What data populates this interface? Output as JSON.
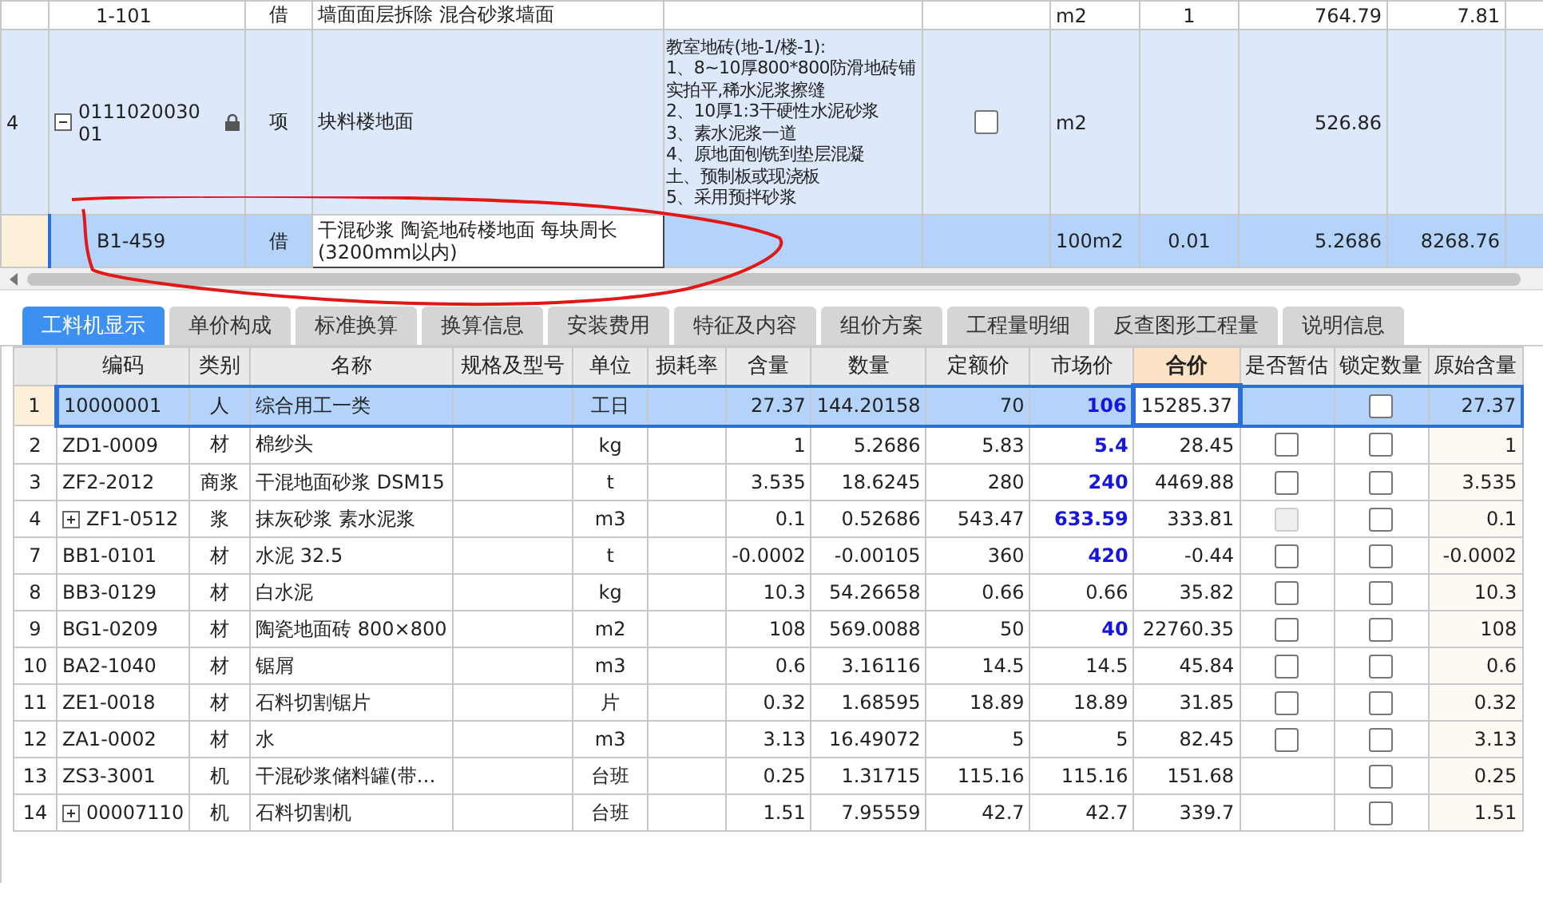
{
  "upper_table": {
    "rows": [
      {
        "row_number": "",
        "code": "1-101",
        "type": "借",
        "name": "墙面面层拆除 混合砂浆墙面",
        "features": [],
        "unit": "m2",
        "quantity": "1",
        "unit_price": "764.79",
        "total": "7.81",
        "selected": false
      },
      {
        "row_number": "4",
        "code": "011102003001",
        "type": "项",
        "name": "块料楼地面",
        "features": [
          "教室地砖(地-1/楼-1):",
          "1、8~10厚800*800防滑地砖铺",
          "实拍平,稀水泥浆擦缝",
          "2、10厚1:3干硬性水泥砂浆",
          "3、素水泥浆一道",
          "4、原地面刨铣到垫层混凝",
          "土、预制板或现浇板",
          "5、采用预拌砂浆"
        ],
        "expanded": true,
        "locked": true,
        "checked": false,
        "unit": "m2",
        "quantity": "",
        "unit_price": "526.86",
        "total": "",
        "selected": false
      },
      {
        "row_number": "",
        "code": "B1-459",
        "type": "借",
        "name": "干混砂浆 陶瓷地砖楼地面 每块周长(3200mm以内)",
        "features": [],
        "unit": "100m2",
        "quantity": "0.01",
        "unit_price": "5.2686",
        "total": "8268.76",
        "selected": true
      }
    ]
  },
  "tabs": [
    {
      "label": "工料机显示",
      "selected": true
    },
    {
      "label": "单价构成",
      "selected": false
    },
    {
      "label": "标准换算",
      "selected": false
    },
    {
      "label": "换算信息",
      "selected": false
    },
    {
      "label": "安装费用",
      "selected": false
    },
    {
      "label": "特征及内容",
      "selected": false
    },
    {
      "label": "组价方案",
      "selected": false
    },
    {
      "label": "工程量明细",
      "selected": false
    },
    {
      "label": "反查图形工程量",
      "selected": false
    },
    {
      "label": "说明信息",
      "selected": false
    }
  ],
  "resource_table": {
    "columns": [
      "编码",
      "类别",
      "名称",
      "规格及型号",
      "单位",
      "损耗率",
      "含量",
      "数量",
      "定额价",
      "市场价",
      "合价",
      "是否暂估",
      "锁定数量",
      "原始含量"
    ],
    "rows": [
      {
        "row_number": "1",
        "code": "10000001",
        "type": "人",
        "name": "综合用工一类",
        "spec": "",
        "unit": "工日",
        "loss_rate": "",
        "content": "27.37",
        "quantity": "144.20158",
        "quota_price": "70",
        "market_price": "106",
        "market_adjusted": true,
        "total": "15285.37",
        "locked": false,
        "original_content": "27.37",
        "selected": true
      },
      {
        "row_number": "2",
        "code": "ZD1-0009",
        "type": "材",
        "name": "棉纱头",
        "spec": "",
        "unit": "kg",
        "loss_rate": "",
        "content": "1",
        "quantity": "5.2686",
        "quota_price": "5.83",
        "market_price": "5.4",
        "market_adjusted": true,
        "total": "28.45",
        "estimate": {
          "checked": false,
          "disabled": false
        },
        "locked": false,
        "original_content": "1",
        "selected": false
      },
      {
        "row_number": "3",
        "code": "ZF2-2012",
        "type": "商浆",
        "name": "干混地面砂浆 DSM15",
        "spec": "",
        "unit": "t",
        "loss_rate": "",
        "content": "3.535",
        "quantity": "18.6245",
        "quota_price": "280",
        "market_price": "240",
        "market_adjusted": true,
        "total": "4469.88",
        "estimate": {
          "checked": false,
          "disabled": false
        },
        "locked": false,
        "original_content": "3.535",
        "selected": false
      },
      {
        "row_number": "4",
        "code": "ZF1-0512",
        "expanded": false,
        "type": "浆",
        "name": "抹灰砂浆 素水泥浆",
        "spec": "",
        "unit": "m3",
        "loss_rate": "",
        "content": "0.1",
        "quantity": "0.52686",
        "quota_price": "543.47",
        "market_price": "633.59",
        "market_adjusted": true,
        "total": "333.81",
        "estimate": {
          "checked": false,
          "disabled": true
        },
        "locked": false,
        "original_content": "0.1",
        "selected": false
      },
      {
        "row_number": "7",
        "code": "BB1-0101",
        "type": "材",
        "name": "水泥 32.5",
        "spec": "",
        "unit": "t",
        "loss_rate": "",
        "content": "-0.0002",
        "quantity": "-0.00105",
        "quota_price": "360",
        "market_price": "420",
        "market_adjusted": true,
        "total": "-0.44",
        "estimate": {
          "checked": false,
          "disabled": false
        },
        "locked": false,
        "original_content": "-0.0002",
        "selected": false
      },
      {
        "row_number": "8",
        "code": "BB3-0129",
        "type": "材",
        "name": "白水泥",
        "spec": "",
        "unit": "kg",
        "loss_rate": "",
        "content": "10.3",
        "quantity": "54.26658",
        "quota_price": "0.66",
        "market_price": "0.66",
        "market_adjusted": false,
        "total": "35.82",
        "estimate": {
          "checked": false,
          "disabled": false
        },
        "locked": false,
        "original_content": "10.3",
        "selected": false
      },
      {
        "row_number": "9",
        "code": "BG1-0209",
        "type": "材",
        "name": "陶瓷地面砖 800×800",
        "spec": "",
        "unit": "m2",
        "loss_rate": "",
        "content": "108",
        "quantity": "569.0088",
        "quota_price": "50",
        "market_price": "40",
        "market_adjusted": true,
        "total": "22760.35",
        "estimate": {
          "checked": false,
          "disabled": false
        },
        "locked": false,
        "original_content": "108",
        "selected": false
      },
      {
        "row_number": "10",
        "code": "BA2-1040",
        "type": "材",
        "name": "锯屑",
        "spec": "",
        "unit": "m3",
        "loss_rate": "",
        "content": "0.6",
        "quantity": "3.16116",
        "quota_price": "14.5",
        "market_price": "14.5",
        "market_adjusted": false,
        "total": "45.84",
        "estimate": {
          "checked": false,
          "disabled": false
        },
        "locked": false,
        "original_content": "0.6",
        "selected": false
      },
      {
        "row_number": "11",
        "code": "ZE1-0018",
        "type": "材",
        "name": "石料切割锯片",
        "spec": "",
        "unit": "片",
        "loss_rate": "",
        "content": "0.32",
        "quantity": "1.68595",
        "quota_price": "18.89",
        "market_price": "18.89",
        "market_adjusted": false,
        "total": "31.85",
        "estimate": {
          "checked": false,
          "disabled": false
        },
        "locked": false,
        "original_content": "0.32",
        "selected": false
      },
      {
        "row_number": "12",
        "code": "ZA1-0002",
        "type": "材",
        "name": "水",
        "spec": "",
        "unit": "m3",
        "loss_rate": "",
        "content": "3.13",
        "quantity": "16.49072",
        "quota_price": "5",
        "market_price": "5",
        "market_adjusted": false,
        "total": "82.45",
        "estimate": {
          "checked": false,
          "disabled": false
        },
        "locked": false,
        "original_content": "3.13",
        "selected": false
      },
      {
        "row_number": "13",
        "code": "ZS3-3001",
        "type": "机",
        "name": "干混砂浆储料罐(带…",
        "spec": "",
        "unit": "台班",
        "loss_rate": "",
        "content": "0.25",
        "quantity": "1.31715",
        "quota_price": "115.16",
        "market_price": "115.16",
        "market_adjusted": false,
        "total": "151.68",
        "locked": false,
        "original_content": "0.25",
        "selected": false
      },
      {
        "row_number": "14",
        "code": "00007110",
        "expanded": false,
        "type": "机",
        "name": "石料切割机",
        "spec": "",
        "unit": "台班",
        "loss_rate": "",
        "content": "1.51",
        "quantity": "7.95559",
        "quota_price": "42.7",
        "market_price": "42.7",
        "market_adjusted": false,
        "total": "339.7",
        "locked": false,
        "original_content": "1.51",
        "selected": false
      }
    ]
  }
}
